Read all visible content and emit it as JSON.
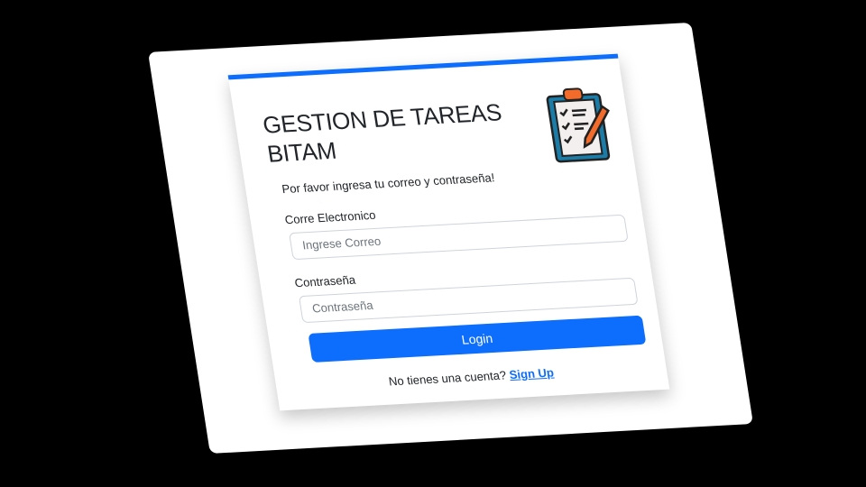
{
  "login": {
    "title": "GESTION DE TAREAS BITAM",
    "subtitle": "Por favor ingresa tu correo y contraseña!",
    "email_label": "Corre Electronico",
    "email_placeholder": "Ingrese Correo",
    "password_label": "Contraseña",
    "password_placeholder": "Contraseña",
    "login_button": "Login",
    "signup_prompt": "No tienes una cuenta?",
    "signup_link": "Sign Up"
  },
  "colors": {
    "accent": "#0d6efd",
    "icon_orange": "#f26b2a",
    "icon_teal": "#1c7ca8"
  },
  "icons": {
    "logo": "clipboard-checklist-icon"
  }
}
